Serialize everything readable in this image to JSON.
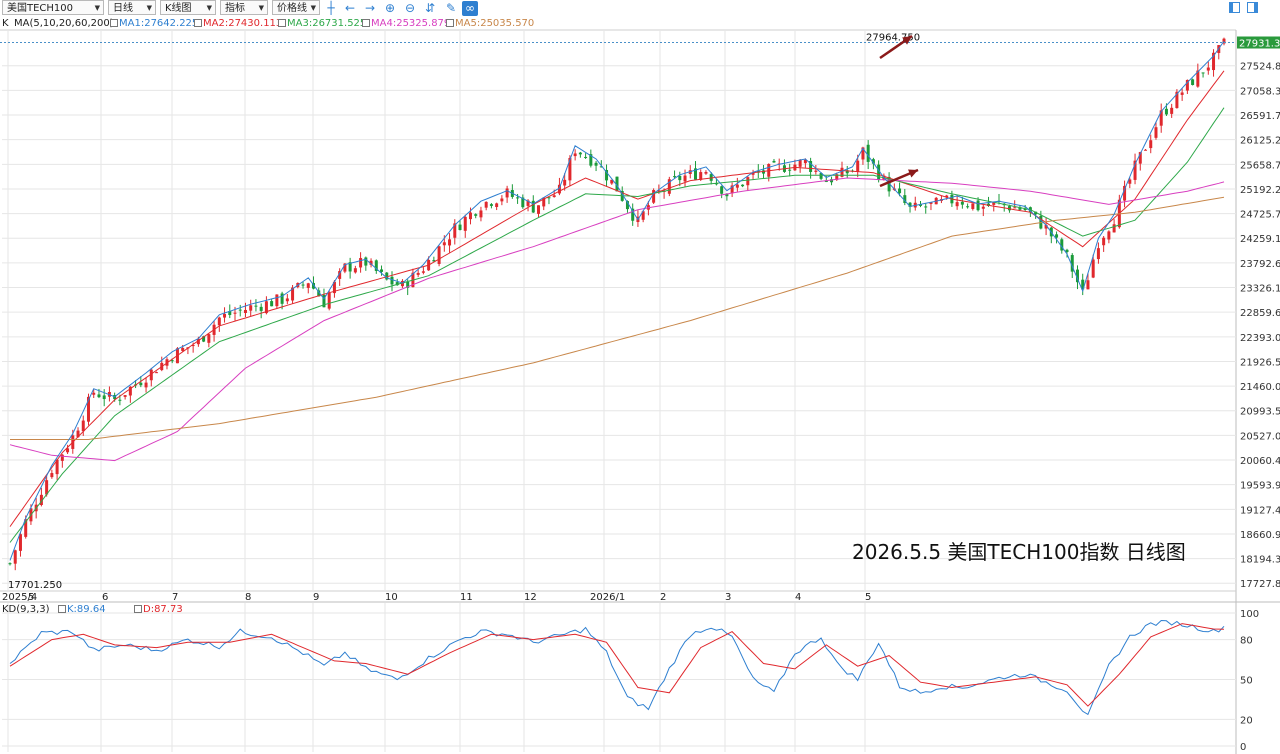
{
  "toolbar": {
    "symbol": "美国TECH100",
    "period": "日线",
    "chart_type": "K线图",
    "indicator": "指标",
    "price_line": "价格线",
    "icons": [
      "crosshair-icon",
      "arrow-left-icon",
      "arrow-right-icon",
      "zoom-in-icon",
      "zoom-out-icon",
      "fit-icon",
      "pencil-icon",
      "link-icon"
    ],
    "window_icons": [
      "panel-left-icon",
      "panel-right-icon"
    ]
  },
  "main_legend": {
    "k_label": "K",
    "ma_label": "MA(5,10,20,60,200)",
    "ma1": "MA1:27642.225",
    "ma2": "MA2:27430.113",
    "ma3": "MA3:26731.525",
    "ma4": "MA4:25325.879",
    "ma5": "MA5:25035.570"
  },
  "kd_legend": {
    "label": "KD(9,3,3)",
    "k": "K:89.64",
    "d": "D:87.73"
  },
  "colors": {
    "up": "#e0282d",
    "down": "#1a9a3a",
    "ma1": "#2e7fd0",
    "ma2": "#e0282d",
    "ma3": "#2ea84a",
    "ma4": "#d83fc0",
    "ma5": "#c8874a",
    "grid": "#e6e6e6",
    "current_price_bg": "#2a9a3c",
    "arrow": "#8b1a1a"
  },
  "chart_data": {
    "type": "candlestick",
    "high_label": "27964.750",
    "low_label": "17701.250",
    "current_price": "27931.37",
    "price_ticks": [
      "27524.84",
      "27058.31",
      "26591.79",
      "26125.27",
      "25658.75",
      "25192.22",
      "24725.70",
      "24259.18",
      "23792.65",
      "23326.13",
      "22859.61",
      "22393.09",
      "21926.56",
      "21460.04",
      "20993.52",
      "20527.00",
      "20060.47",
      "19593.95",
      "19127.43",
      "18660.90",
      "18194.38",
      "17727.86"
    ],
    "x_labels": [
      "2025/4",
      "5",
      "6",
      "7",
      "8",
      "9",
      "10",
      "11",
      "12",
      "2026/1",
      "2",
      "3",
      "4",
      "5"
    ],
    "kd_ticks": [
      "100",
      "80",
      "50",
      "20",
      "0"
    ],
    "ylim": [
      17600,
      28050
    ],
    "close_path": [
      [
        0,
        18100
      ],
      [
        3,
        18900
      ],
      [
        8,
        19900
      ],
      [
        12,
        20500
      ],
      [
        16,
        21350
      ],
      [
        20,
        21200
      ],
      [
        26,
        21650
      ],
      [
        31,
        22050
      ],
      [
        36,
        22300
      ],
      [
        40,
        22750
      ],
      [
        46,
        22950
      ],
      [
        52,
        23100
      ],
      [
        57,
        23450
      ],
      [
        60,
        23050
      ],
      [
        64,
        23700
      ],
      [
        68,
        23800
      ],
      [
        72,
        23450
      ],
      [
        75,
        23350
      ],
      [
        79,
        23700
      ],
      [
        85,
        24450
      ],
      [
        90,
        24900
      ],
      [
        95,
        25100
      ],
      [
        100,
        24850
      ],
      [
        105,
        25150
      ],
      [
        108,
        25950
      ],
      [
        112,
        25700
      ],
      [
        116,
        25200
      ],
      [
        120,
        24550
      ],
      [
        123,
        25050
      ],
      [
        128,
        25400
      ],
      [
        133,
        25550
      ],
      [
        137,
        25100
      ],
      [
        142,
        25450
      ],
      [
        147,
        25600
      ],
      [
        152,
        25700
      ],
      [
        156,
        25350
      ],
      [
        161,
        25550
      ],
      [
        163,
        25900
      ],
      [
        167,
        25350
      ],
      [
        172,
        24800
      ],
      [
        177,
        24900
      ],
      [
        181,
        25000
      ],
      [
        185,
        24850
      ],
      [
        189,
        24900
      ],
      [
        194,
        24800
      ],
      [
        198,
        24450
      ],
      [
        202,
        23900
      ],
      [
        205,
        23200
      ],
      [
        208,
        24200
      ],
      [
        211,
        24650
      ],
      [
        215,
        25600
      ],
      [
        220,
        26600
      ],
      [
        225,
        27150
      ],
      [
        230,
        27650
      ],
      [
        232,
        27931
      ]
    ],
    "ma_series": [
      {
        "values": [
          [
            0,
            18800
          ],
          [
            10,
            20200
          ],
          [
            20,
            21200
          ],
          [
            40,
            22600
          ],
          [
            60,
            23200
          ],
          [
            80,
            23750
          ],
          [
            100,
            24900
          ],
          [
            110,
            25400
          ],
          [
            120,
            25000
          ],
          [
            130,
            25350
          ],
          [
            150,
            25600
          ],
          [
            165,
            25500
          ],
          [
            180,
            25000
          ],
          [
            195,
            24750
          ],
          [
            205,
            24100
          ],
          [
            215,
            25000
          ],
          [
            225,
            26500
          ],
          [
            232,
            27430
          ]
        ]
      },
      {
        "values": [
          [
            0,
            18500
          ],
          [
            10,
            19800
          ],
          [
            20,
            20900
          ],
          [
            40,
            22300
          ],
          [
            60,
            23000
          ],
          [
            80,
            23550
          ],
          [
            100,
            24600
          ],
          [
            110,
            25100
          ],
          [
            120,
            25050
          ],
          [
            130,
            25250
          ],
          [
            150,
            25450
          ],
          [
            165,
            25450
          ],
          [
            180,
            25100
          ],
          [
            195,
            24800
          ],
          [
            205,
            24300
          ],
          [
            215,
            24600
          ],
          [
            225,
            25700
          ],
          [
            232,
            26731
          ]
        ]
      },
      {
        "values": [
          [
            0,
            20350
          ],
          [
            8,
            20150
          ],
          [
            20,
            20050
          ],
          [
            32,
            20600
          ],
          [
            45,
            21800
          ],
          [
            60,
            22700
          ],
          [
            80,
            23500
          ],
          [
            100,
            24100
          ],
          [
            120,
            24800
          ],
          [
            140,
            25150
          ],
          [
            160,
            25400
          ],
          [
            180,
            25300
          ],
          [
            195,
            25150
          ],
          [
            210,
            24900
          ],
          [
            225,
            25150
          ],
          [
            232,
            25325
          ]
        ]
      },
      {
        "values": [
          [
            0,
            20450
          ],
          [
            15,
            20450
          ],
          [
            40,
            20750
          ],
          [
            70,
            21250
          ],
          [
            100,
            21900
          ],
          [
            130,
            22700
          ],
          [
            160,
            23600
          ],
          [
            180,
            24300
          ],
          [
            200,
            24600
          ],
          [
            215,
            24750
          ],
          [
            232,
            25035
          ]
        ]
      }
    ],
    "kd_k_path": [
      [
        0,
        62
      ],
      [
        6,
        85
      ],
      [
        12,
        86
      ],
      [
        16,
        72
      ],
      [
        22,
        76
      ],
      [
        28,
        72
      ],
      [
        34,
        80
      ],
      [
        40,
        75
      ],
      [
        44,
        86
      ],
      [
        50,
        82
      ],
      [
        56,
        70
      ],
      [
        60,
        60
      ],
      [
        64,
        70
      ],
      [
        68,
        58
      ],
      [
        74,
        50
      ],
      [
        80,
        66
      ],
      [
        86,
        80
      ],
      [
        90,
        86
      ],
      [
        95,
        84
      ],
      [
        100,
        78
      ],
      [
        104,
        82
      ],
      [
        110,
        88
      ],
      [
        114,
        70
      ],
      [
        118,
        36
      ],
      [
        122,
        28
      ],
      [
        126,
        58
      ],
      [
        130,
        84
      ],
      [
        134,
        90
      ],
      [
        138,
        82
      ],
      [
        142,
        50
      ],
      [
        146,
        40
      ],
      [
        150,
        70
      ],
      [
        155,
        82
      ],
      [
        158,
        62
      ],
      [
        162,
        50
      ],
      [
        166,
        78
      ],
      [
        170,
        45
      ],
      [
        174,
        40
      ],
      [
        178,
        45
      ],
      [
        182,
        44
      ],
      [
        186,
        48
      ],
      [
        190,
        52
      ],
      [
        194,
        54
      ],
      [
        198,
        48
      ],
      [
        202,
        42
      ],
      [
        206,
        22
      ],
      [
        210,
        60
      ],
      [
        214,
        82
      ],
      [
        218,
        92
      ],
      [
        222,
        93
      ],
      [
        226,
        90
      ],
      [
        230,
        86
      ],
      [
        232,
        89.64
      ]
    ],
    "kd_d_path": [
      [
        0,
        60
      ],
      [
        8,
        80
      ],
      [
        14,
        84
      ],
      [
        20,
        76
      ],
      [
        28,
        74
      ],
      [
        34,
        78
      ],
      [
        42,
        78
      ],
      [
        50,
        84
      ],
      [
        56,
        74
      ],
      [
        62,
        64
      ],
      [
        68,
        62
      ],
      [
        76,
        54
      ],
      [
        84,
        70
      ],
      [
        92,
        84
      ],
      [
        100,
        80
      ],
      [
        108,
        84
      ],
      [
        114,
        78
      ],
      [
        120,
        44
      ],
      [
        126,
        40
      ],
      [
        132,
        74
      ],
      [
        138,
        86
      ],
      [
        144,
        62
      ],
      [
        150,
        58
      ],
      [
        156,
        76
      ],
      [
        162,
        60
      ],
      [
        168,
        68
      ],
      [
        174,
        48
      ],
      [
        180,
        44
      ],
      [
        188,
        48
      ],
      [
        196,
        52
      ],
      [
        202,
        46
      ],
      [
        206,
        30
      ],
      [
        212,
        54
      ],
      [
        218,
        82
      ],
      [
        224,
        92
      ],
      [
        230,
        88
      ],
      [
        232,
        87.73
      ]
    ]
  },
  "annotation": "2026.5.5 美国TECH100指数 日线图"
}
